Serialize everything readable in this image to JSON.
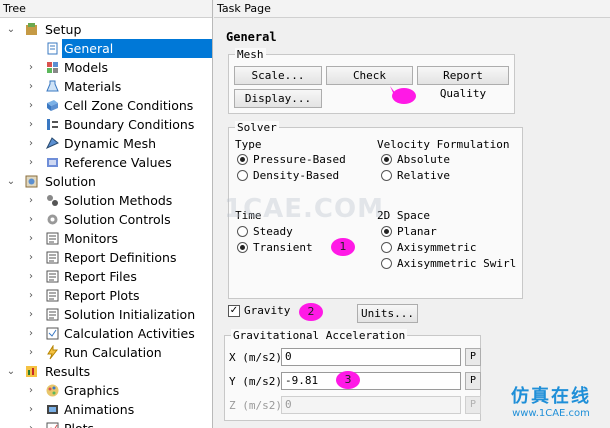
{
  "tree": {
    "header": "Tree",
    "items": [
      {
        "label": "Setup",
        "icon": "setup-icon",
        "expanded": true,
        "level": 0
      },
      {
        "label": "General",
        "icon": "general-icon",
        "level": 1,
        "selected": true
      },
      {
        "label": "Models",
        "icon": "models-icon",
        "level": 1
      },
      {
        "label": "Materials",
        "icon": "materials-icon",
        "level": 1
      },
      {
        "label": "Cell Zone Conditions",
        "icon": "cell-zone-icon",
        "level": 1
      },
      {
        "label": "Boundary Conditions",
        "icon": "boundary-icon",
        "level": 1
      },
      {
        "label": "Dynamic Mesh",
        "icon": "dynamic-mesh-icon",
        "level": 1
      },
      {
        "label": "Reference Values",
        "icon": "reference-values-icon",
        "level": 1
      },
      {
        "label": "Solution",
        "icon": "solution-icon",
        "expanded": true,
        "level": 0
      },
      {
        "label": "Solution Methods",
        "icon": "solution-methods-icon",
        "level": 1
      },
      {
        "label": "Solution Controls",
        "icon": "solution-controls-icon",
        "level": 1
      },
      {
        "label": "Monitors",
        "icon": "monitors-icon",
        "level": 1
      },
      {
        "label": "Report Definitions",
        "icon": "report-definitions-icon",
        "level": 1
      },
      {
        "label": "Report Files",
        "icon": "report-files-icon",
        "level": 1
      },
      {
        "label": "Report Plots",
        "icon": "report-plots-icon",
        "level": 1
      },
      {
        "label": "Solution Initialization",
        "icon": "solution-init-icon",
        "level": 1
      },
      {
        "label": "Calculation Activities",
        "icon": "calc-activities-icon",
        "level": 1
      },
      {
        "label": "Run Calculation",
        "icon": "run-calculation-icon",
        "level": 1
      },
      {
        "label": "Results",
        "icon": "results-icon",
        "expanded": true,
        "level": 0
      },
      {
        "label": "Graphics",
        "icon": "graphics-icon",
        "level": 1
      },
      {
        "label": "Animations",
        "icon": "animations-icon",
        "level": 1
      },
      {
        "label": "Plots",
        "icon": "plots-icon",
        "level": 1
      }
    ]
  },
  "task": {
    "header": "Task Page",
    "title": "General",
    "mesh": {
      "title": "Mesh",
      "scale": "Scale...",
      "check": "Check",
      "report_quality": "Report Quality",
      "display": "Display..."
    },
    "solver": {
      "title": "Solver",
      "type_label": "Type",
      "type_options": [
        "Pressure-Based",
        "Density-Based"
      ],
      "velocity_label": "Velocity Formulation",
      "velocity_options": [
        "Absolute",
        "Relative"
      ],
      "time_label": "Time",
      "time_options": [
        "Steady",
        "Transient"
      ],
      "space_label": "2D Space",
      "space_options": [
        "Planar",
        "Axisymmetric",
        "Axisymmetric Swirl"
      ]
    },
    "gravity_label": "Gravity",
    "units_button": "Units...",
    "gravity": {
      "title": "Gravitational Acceleration",
      "x_label": "X (m/s2)",
      "x_value": "0",
      "y_label": "Y (m/s2)",
      "y_value": "-9.81",
      "z_label": "Z (m/s2)",
      "z_value": "0",
      "p_label": "P"
    },
    "annotations": [
      "1",
      "2",
      "3"
    ],
    "watermark": "1CAE.COM",
    "logo_text": "仿真在线",
    "logo_url": "www.1CAE.com"
  },
  "colors": {
    "selection": "#0078d7",
    "annotation": "#ff19e6"
  }
}
